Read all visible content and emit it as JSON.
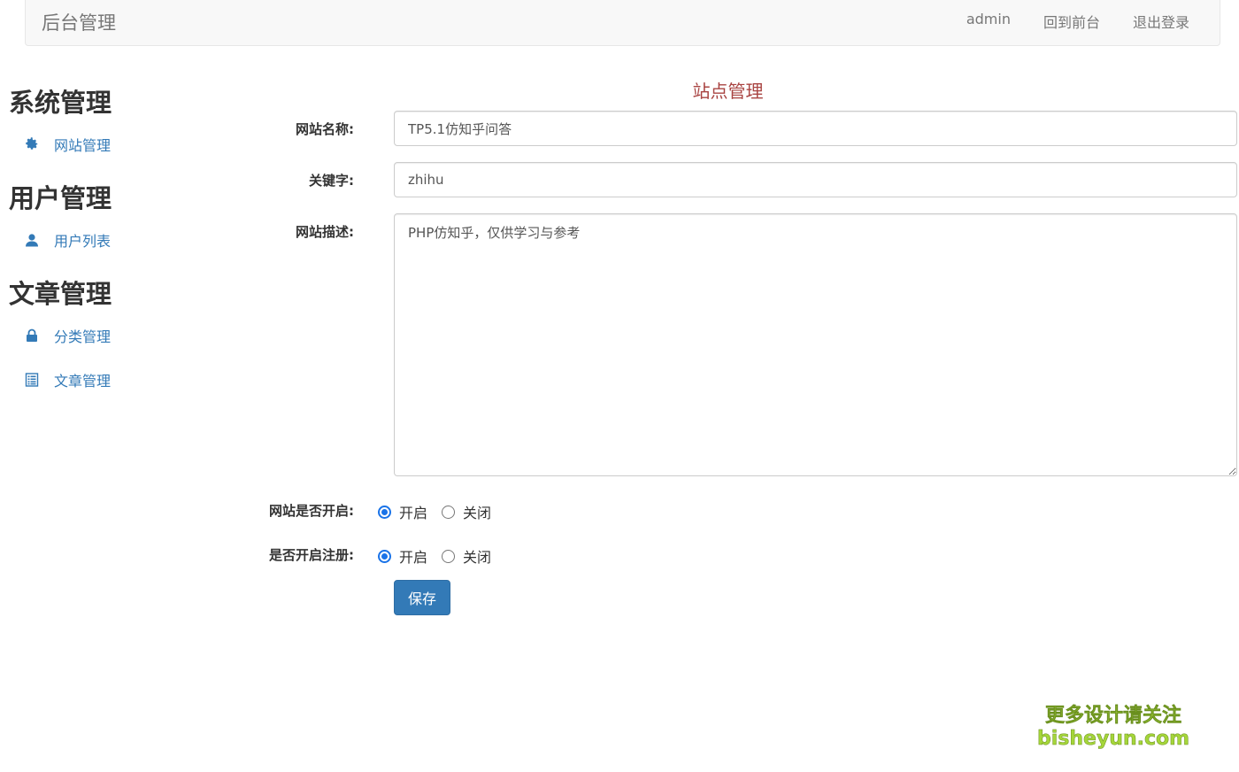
{
  "navbar": {
    "brand": "后台管理",
    "links": [
      "admin",
      "回到前台",
      "退出登录"
    ]
  },
  "sidebar": {
    "groups": [
      {
        "title": "系统管理",
        "items": [
          {
            "label": "网站管理",
            "icon": "gear-icon"
          }
        ]
      },
      {
        "title": "用户管理",
        "items": [
          {
            "label": "用户列表",
            "icon": "user-icon"
          }
        ]
      },
      {
        "title": "文章管理",
        "items": [
          {
            "label": "分类管理",
            "icon": "lock-icon"
          },
          {
            "label": "文章管理",
            "icon": "list-icon"
          }
        ]
      }
    ]
  },
  "form": {
    "title": "站点管理",
    "site_name": {
      "label": "网站名称:",
      "value": "TP5.1仿知乎问答"
    },
    "keywords": {
      "label": "关键字:",
      "value": "zhihu"
    },
    "description": {
      "label": "网站描述:",
      "value": "PHP仿知乎，仅供学习与参考"
    },
    "site_open": {
      "label": "网站是否开启:",
      "options": [
        "开启",
        "关闭"
      ],
      "selected": "开启"
    },
    "register_open": {
      "label": "是否开启注册:",
      "options": [
        "开启",
        "关闭"
      ],
      "selected": "开启"
    },
    "save_label": "保存"
  },
  "watermark": {
    "line1": "更多设计请关注",
    "line2": "bisheyun.com"
  },
  "colors": {
    "accent": "#337ab7",
    "title": "#a94442",
    "radio": "#1a73e8"
  }
}
